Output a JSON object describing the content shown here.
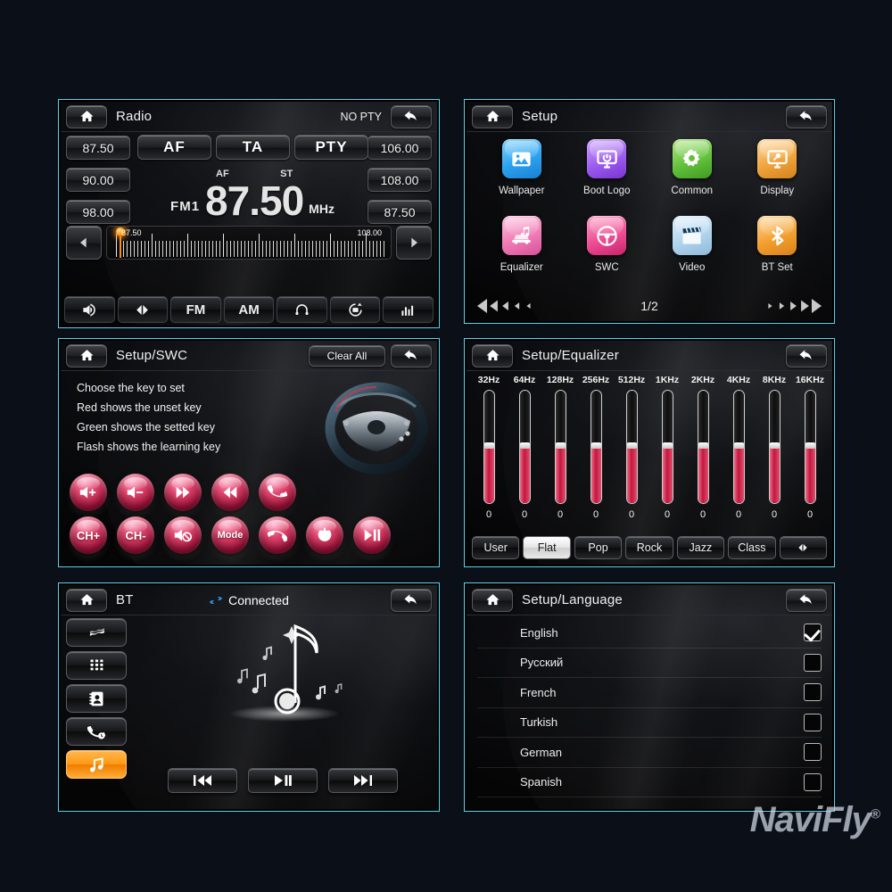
{
  "background_color": "#0b0f18",
  "frame_color": "#5fd0e8",
  "watermark": {
    "text": "NaviFly",
    "mark": "®"
  },
  "radio": {
    "home_icon": "home-icon",
    "title": "Radio",
    "pty_status": "NO PTY",
    "back_icon": "back-arrow-icon",
    "presets_left": [
      "87.50",
      "90.00",
      "98.00"
    ],
    "presets_right": [
      "106.00",
      "108.00",
      "87.50"
    ],
    "function_buttons": [
      "AF",
      "TA",
      "PTY"
    ],
    "band": "FM1",
    "af_tag": "AF",
    "st_tag": "ST",
    "frequency": "87.50",
    "unit": "MHz",
    "scale_low": "87.50",
    "scale_high": "108.00",
    "prev_icon": "triangle-left-icon",
    "next_icon": "triangle-right-icon",
    "toolbar": [
      {
        "label": "",
        "icon": "volume-icon"
      },
      {
        "label": "",
        "icon": "seek-icon"
      },
      {
        "label": "FM",
        "icon": ""
      },
      {
        "label": "AM",
        "icon": ""
      },
      {
        "label": "",
        "icon": "headphone-icon"
      },
      {
        "label": "",
        "icon": "scan-save-icon"
      },
      {
        "label": "",
        "icon": "equalizer-bars-icon"
      }
    ]
  },
  "setup": {
    "title": "Setup",
    "items": [
      {
        "label": "Wallpaper",
        "icon": "picture-icon",
        "color": "#4ab4f5"
      },
      {
        "label": "Boot Logo",
        "icon": "monitor-power-icon",
        "color": "#a96cf0"
      },
      {
        "label": "Common",
        "icon": "gear-icon",
        "color": "#76c846"
      },
      {
        "label": "Display",
        "icon": "monitor-wrench-icon",
        "color": "#f3b055"
      },
      {
        "label": "Equalizer",
        "icon": "car-music-icon",
        "color": "#f087b8"
      },
      {
        "label": "SWC",
        "icon": "steering-wheel-icon",
        "color": "#ee4d93"
      },
      {
        "label": "Video",
        "icon": "clapperboard-icon",
        "color": "#b5d8f0"
      },
      {
        "label": "BT Set",
        "icon": "bluetooth-icon",
        "color": "#f3a94f"
      }
    ],
    "page_indicator": "1/2",
    "prev_icon": "triangle-left-icon",
    "next_icon": "triangle-right-icon"
  },
  "swc": {
    "title": "Setup/SWC",
    "clear_all": "Clear All",
    "instructions": [
      "Choose the key to set",
      "Red shows the unset key",
      "Green shows the setted key",
      "Flash shows the learning key"
    ],
    "wheel_icon": "steering-wheel-illustration",
    "row1": [
      {
        "label": "",
        "icon": "volume-up-icon"
      },
      {
        "label": "",
        "icon": "volume-down-icon"
      },
      {
        "label": "",
        "icon": "next-track-icon"
      },
      {
        "label": "",
        "icon": "prev-track-icon"
      },
      {
        "label": "",
        "icon": "phone-answer-icon"
      }
    ],
    "row2": [
      {
        "label": "CH+",
        "icon": ""
      },
      {
        "label": "CH-",
        "icon": ""
      },
      {
        "label": "",
        "icon": "mute-icon"
      },
      {
        "label": "Mode",
        "icon": ""
      },
      {
        "label": "",
        "icon": "phone-hangup-icon"
      },
      {
        "label": "",
        "icon": "power-icon"
      },
      {
        "label": "",
        "icon": "play-pause-icon"
      }
    ]
  },
  "equalizer": {
    "title": "Setup/Equalizer",
    "presets": [
      "User",
      "Flat",
      "Pop",
      "Rock",
      "Jazz",
      "Class"
    ],
    "active_preset": "Flat",
    "balance_icon": "balance-fader-icon",
    "chart_data": {
      "type": "bar",
      "title": "Setup/Equalizer",
      "categories": [
        "32Hz",
        "64Hz",
        "128Hz",
        "256Hz",
        "512Hz",
        "1KHz",
        "2KHz",
        "4KHz",
        "8KHz",
        "16KHz"
      ],
      "values": [
        0,
        0,
        0,
        0,
        0,
        0,
        0,
        0,
        0,
        0
      ],
      "xlabel": "",
      "ylabel": "",
      "ylim": [
        -10,
        10
      ],
      "grid": false,
      "legend": "none"
    }
  },
  "bt": {
    "title": "BT",
    "status": "Connected",
    "status_icon": "bluetooth-link-icon",
    "tabs": [
      {
        "icon": "bt-pair-icon",
        "active": false
      },
      {
        "icon": "keypad-icon",
        "active": false
      },
      {
        "icon": "contacts-icon",
        "active": false
      },
      {
        "icon": "call-log-icon",
        "active": false
      },
      {
        "icon": "music-note-icon",
        "active": true
      }
    ],
    "controls": [
      {
        "icon": "prev-track-icon"
      },
      {
        "icon": "play-pause-icon"
      },
      {
        "icon": "next-track-icon"
      }
    ]
  },
  "language": {
    "title": "Setup/Language",
    "options": [
      {
        "name": "English",
        "checked": true
      },
      {
        "name": "Русский",
        "checked": false
      },
      {
        "name": "French",
        "checked": false
      },
      {
        "name": "Turkish",
        "checked": false
      },
      {
        "name": "German",
        "checked": false
      },
      {
        "name": "Spanish",
        "checked": false
      }
    ]
  }
}
